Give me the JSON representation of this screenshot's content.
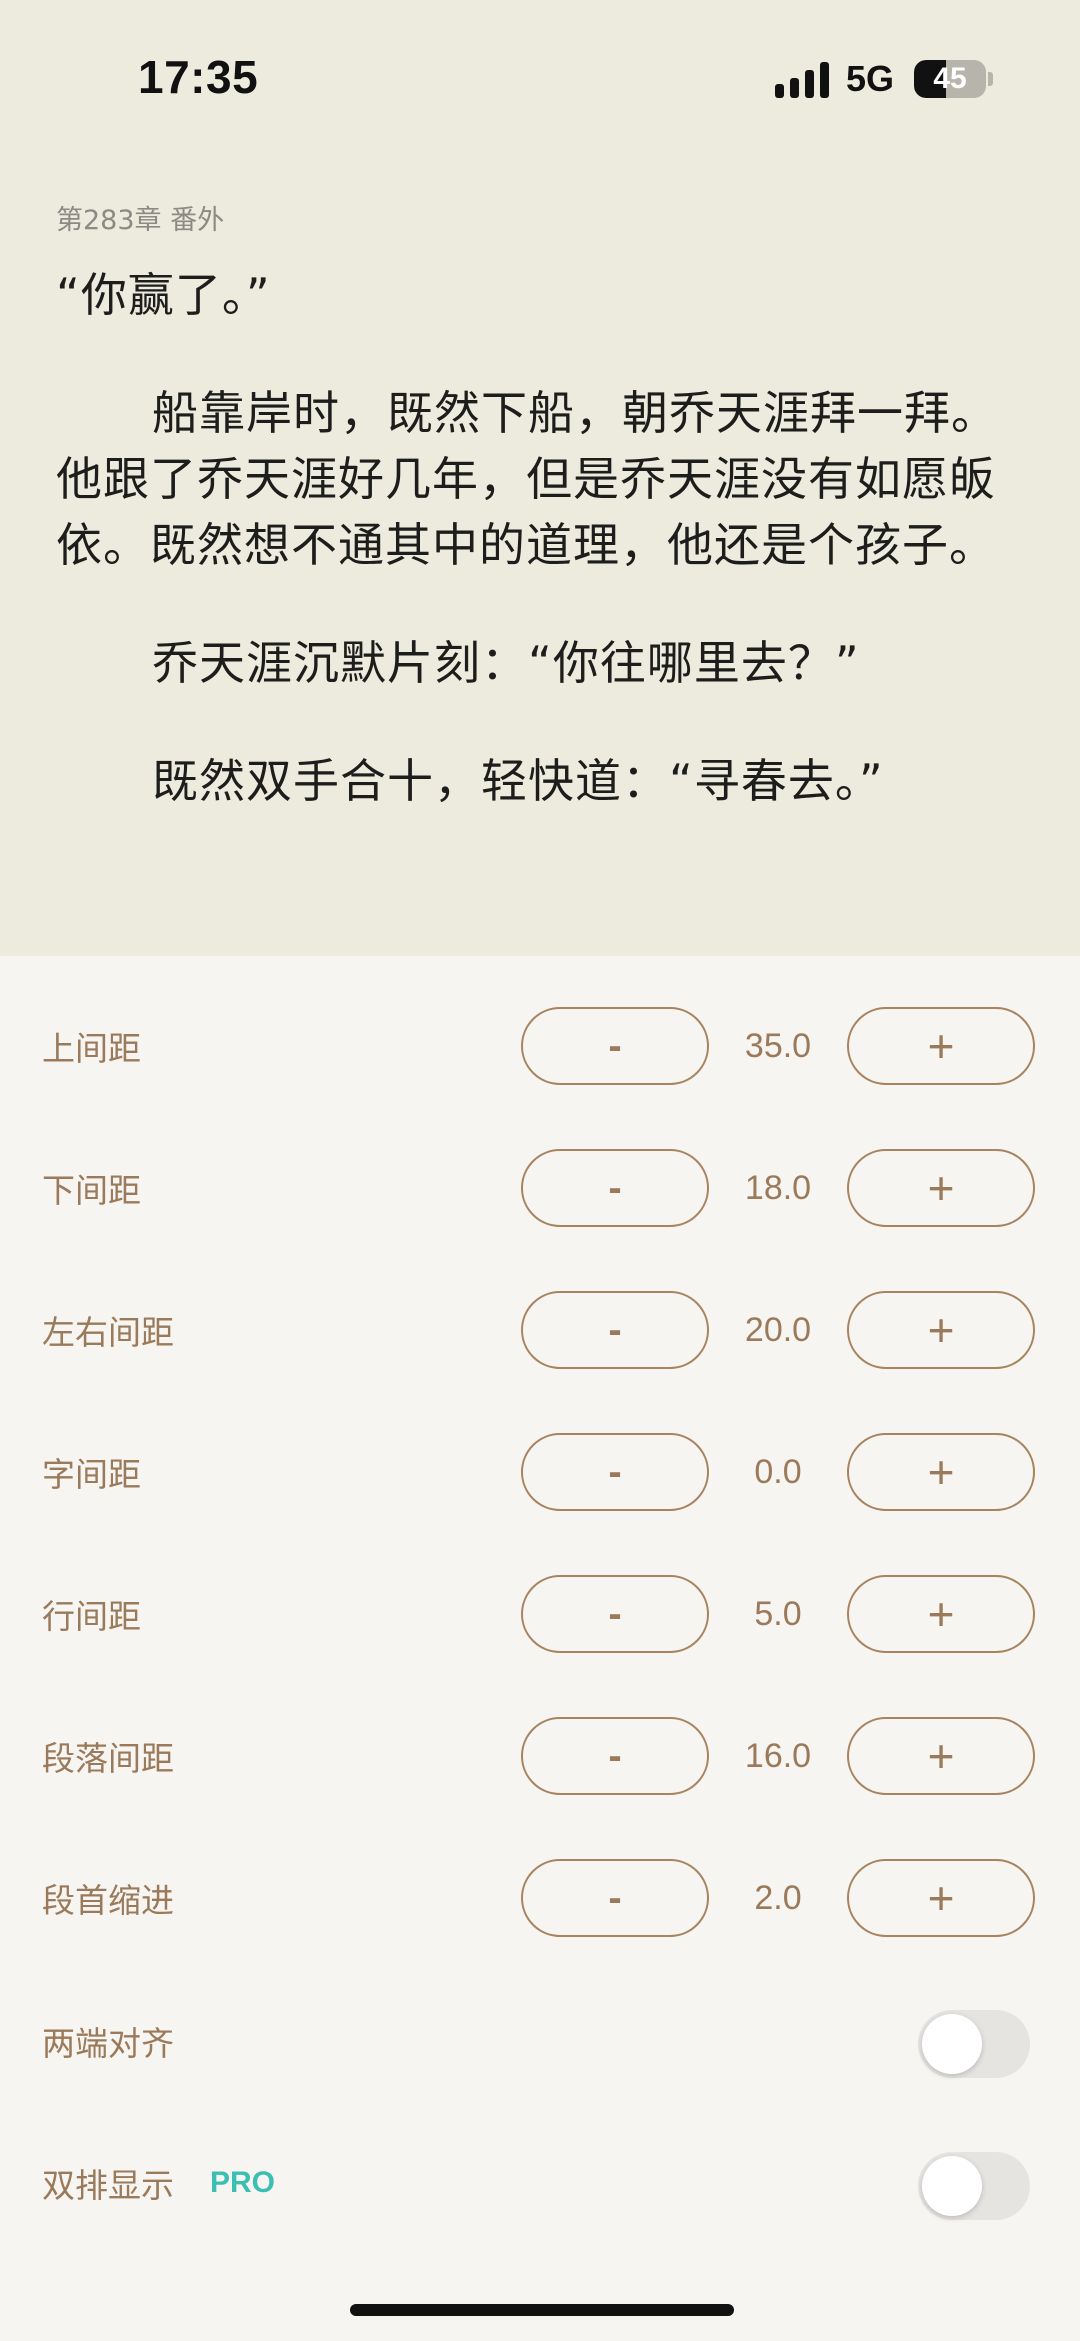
{
  "status_bar": {
    "time": "17:35",
    "network": "5G",
    "battery_percent": "45",
    "battery_level": 0.45
  },
  "reader": {
    "chapter_title": "第283章 番外",
    "paragraphs": [
      "“你赢了。”",
      "船靠岸时，既然下船，朝乔天涯拜一拜。他跟了乔天涯好几年，但是乔天涯没有如愿皈依。既然想不通其中的道理，他还是个孩子。",
      "乔天涯沉默片刻：“你往哪里去？”",
      "既然双手合十，轻快道：“寻春去。”",
      "",
      "",
      "",
      "",
      "",
      "",
      "",
      "",
      "",
      "",
      "",
      "",
      "",
      "",
      "",
      "",
      ""
    ]
  },
  "settings": {
    "minus_label": "-",
    "plus_label": "+",
    "rows": [
      {
        "label": "上间距",
        "value": "35.0"
      },
      {
        "label": "下间距",
        "value": "18.0"
      },
      {
        "label": "左右间距",
        "value": "20.0"
      },
      {
        "label": "字间距",
        "value": "0.0"
      },
      {
        "label": "行间距",
        "value": "5.0"
      },
      {
        "label": "段落间距",
        "value": "16.0"
      },
      {
        "label": "段首缩进",
        "value": "2.0"
      }
    ],
    "toggles": [
      {
        "label": "两端对齐",
        "on": false
      },
      {
        "label": "双排显示",
        "badge": "PRO",
        "on": false
      }
    ]
  },
  "colors": {
    "reader_bg": "#edeade",
    "panel_bg": "#f7f5f1",
    "accent_brown": "#9a7a5a",
    "pro_teal": "#3bbfb2"
  }
}
